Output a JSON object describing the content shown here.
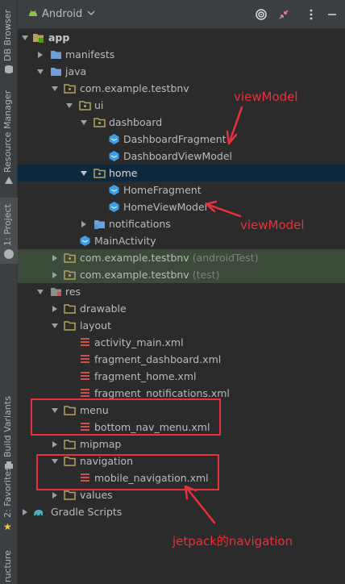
{
  "tool_strip": {
    "tabs": [
      {
        "label": "DB Browser"
      },
      {
        "label": "Resource Manager"
      },
      {
        "label": "1: Project"
      },
      {
        "label": "Build Variants"
      },
      {
        "label": "2: Favorites"
      },
      {
        "label": "ructure"
      }
    ]
  },
  "header": {
    "view_label": "Android"
  },
  "tree": {
    "app": "app",
    "manifests": "manifests",
    "java": "java",
    "pkg_main": "com.example.testbnv",
    "ui": "ui",
    "dashboard": "dashboard",
    "dashboard_fragment": "DashboardFragment",
    "dashboard_viewmodel": "DashboardViewModel",
    "home": "home",
    "home_fragment": "HomeFragment",
    "home_viewmodel": "HomeViewModel",
    "notifications": "notifications",
    "main_activity": "MainActivity",
    "pkg_android_test": "com.example.testbnv",
    "pkg_android_test_tag": "(androidTest)",
    "pkg_test": "com.example.testbnv",
    "pkg_test_tag": "(test)",
    "res": "res",
    "drawable": "drawable",
    "layout": "layout",
    "activity_main": "activity_main.xml",
    "fragment_dashboard": "fragment_dashboard.xml",
    "fragment_home": "fragment_home.xml",
    "fragment_notifications": "fragment_notifications.xml",
    "menu": "menu",
    "bottom_nav_menu": "bottom_nav_menu.xml",
    "mipmap": "mipmap",
    "navigation": "navigation",
    "mobile_navigation": "mobile_navigation.xml",
    "values": "values",
    "gradle_scripts": "Gradle Scripts"
  },
  "annotations": {
    "viewmodel_top": "viewModel",
    "viewmodel_bottom": "viewModel",
    "jetpack_nav": "jetpack的navigation"
  },
  "colors": {
    "annotation_red": "#e8313a",
    "folder": "#b3a35f",
    "class_icon": "#3f9ee8",
    "selected_row": "#0d293e"
  }
}
